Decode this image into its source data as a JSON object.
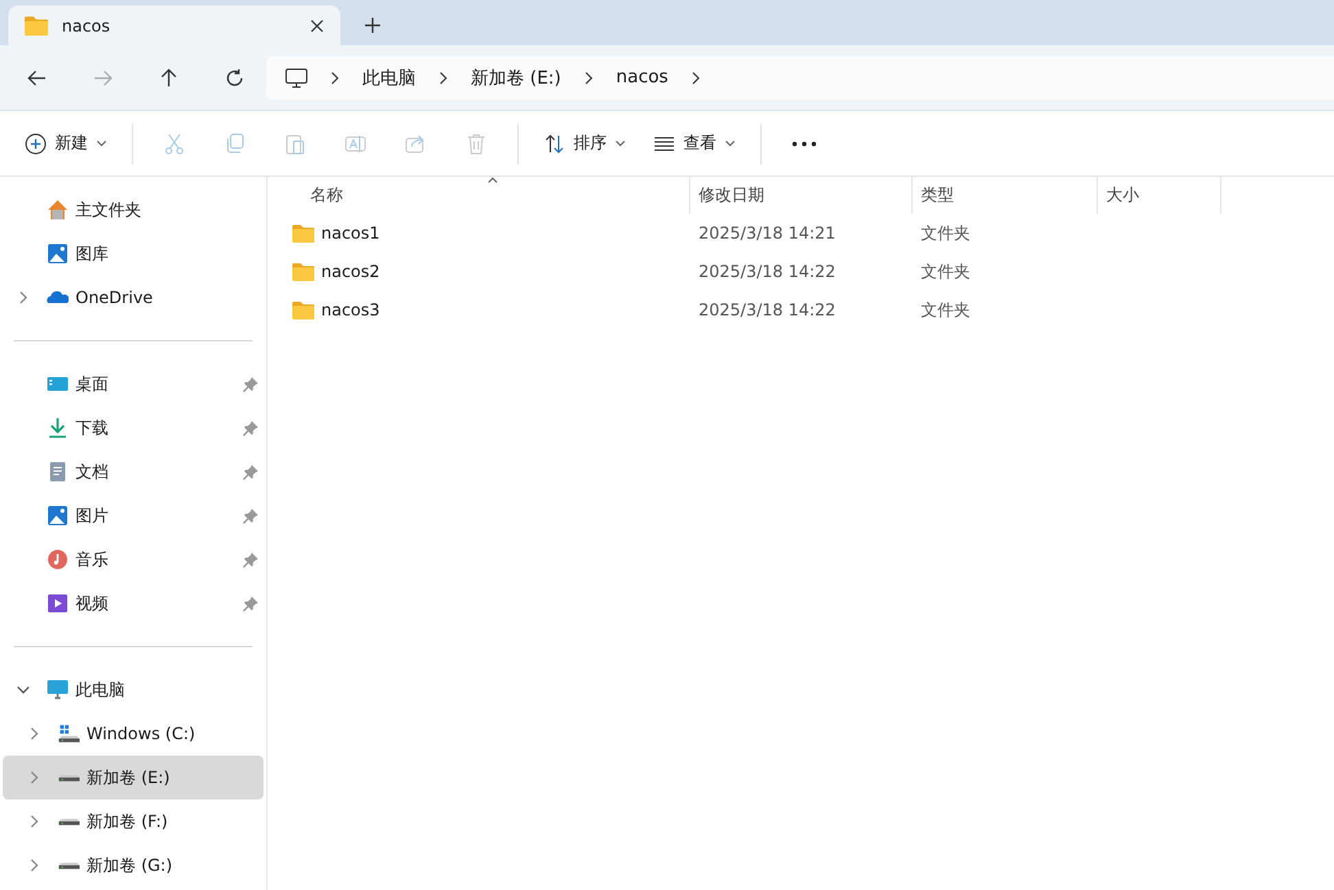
{
  "tab": {
    "title": "nacos"
  },
  "breadcrumb": [
    "此电脑",
    "新加卷 (E:)",
    "nacos"
  ],
  "toolbar": {
    "new_label": "新建",
    "actions": [
      {
        "kind": "cut",
        "disabled": true
      },
      {
        "kind": "copy",
        "disabled": true
      },
      {
        "kind": "paste",
        "disabled": true
      },
      {
        "kind": "rename",
        "disabled": true
      },
      {
        "kind": "share",
        "disabled": true
      },
      {
        "kind": "delete",
        "disabled": true
      }
    ],
    "sort_label": "排序",
    "view_label": "查看"
  },
  "sidebar": {
    "top": [
      {
        "label": "主文件夹",
        "kind": "home",
        "expandable": false,
        "expanded": false
      },
      {
        "label": "图库",
        "kind": "gallery",
        "expandable": false,
        "expanded": false
      },
      {
        "label": "OneDrive",
        "kind": "cloud",
        "expandable": true,
        "expanded": false
      }
    ],
    "quick_access": [
      {
        "label": "桌面",
        "kind": "desktop",
        "pinned": true
      },
      {
        "label": "下载",
        "kind": "download",
        "pinned": true
      },
      {
        "label": "文档",
        "kind": "document",
        "pinned": true
      },
      {
        "label": "图片",
        "kind": "pictures",
        "pinned": true
      },
      {
        "label": "音乐",
        "kind": "music",
        "pinned": true
      },
      {
        "label": "视频",
        "kind": "video",
        "pinned": true
      }
    ],
    "this_pc": {
      "label": "此电脑",
      "expanded": true,
      "children": [
        {
          "label": "Windows (C:)",
          "kind": "system-drive",
          "expanded": false,
          "selected": false
        },
        {
          "label": "新加卷 (E:)",
          "kind": "drive",
          "expanded": false,
          "selected": true
        },
        {
          "label": "新加卷 (F:)",
          "kind": "drive",
          "expanded": false,
          "selected": false
        },
        {
          "label": "新加卷 (G:)",
          "kind": "drive",
          "expanded": false,
          "selected": false
        }
      ]
    }
  },
  "columns": [
    {
      "label": "名称",
      "sorted": true
    },
    {
      "label": "修改日期",
      "sorted": false
    },
    {
      "label": "类型",
      "sorted": false
    },
    {
      "label": "大小",
      "sorted": false
    }
  ],
  "rows": [
    {
      "name": "nacos1",
      "modified": "2025/3/18 14:21",
      "type": "文件夹"
    },
    {
      "name": "nacos2",
      "modified": "2025/3/18 14:22",
      "type": "文件夹"
    },
    {
      "name": "nacos3",
      "modified": "2025/3/18 14:22",
      "type": "文件夹"
    }
  ]
}
